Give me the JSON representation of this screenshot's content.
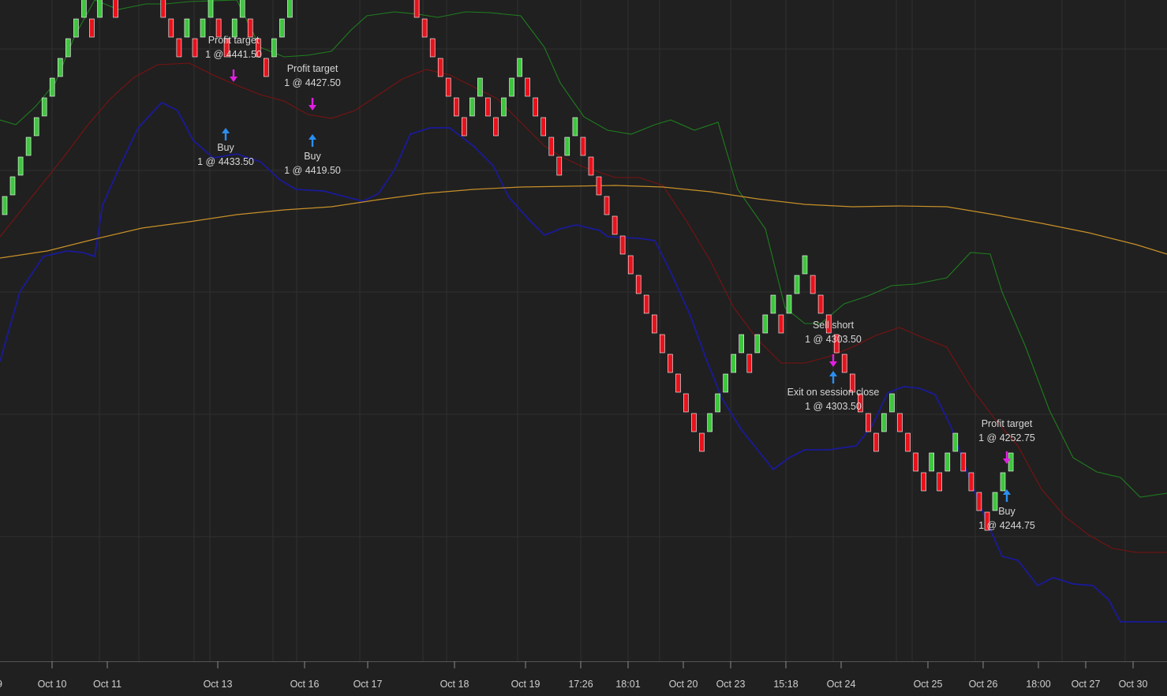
{
  "chart_data": {
    "type": "renko-candlestick",
    "grid": true,
    "colors": {
      "background": "#202020",
      "grid": "#303030",
      "up_bar": "#3ec63e",
      "down_bar": "#e8121c",
      "upper_band": "#1f7d1f",
      "middle_band": "#7a1212",
      "lower_band": "#1a1a9a",
      "long_ma": "#c89028",
      "buy_marker": "#2b8ff0",
      "exit_marker": "#e020e0"
    },
    "x_tick_labels": [
      "Oct 10",
      "Oct 11",
      "Oct 13",
      "Oct 16",
      "Oct 17",
      "Oct 18",
      "Oct 19",
      "17:26",
      "18:01",
      "Oct 20",
      "Oct 23",
      "15:18",
      "Oct 24",
      "Oct 25",
      "Oct 26",
      "18:00",
      "Oct 27",
      "Oct 30"
    ],
    "bricks": [
      "up",
      "up",
      "up",
      "up",
      "up",
      "up",
      "up",
      "up",
      "up",
      "up",
      "up",
      "down",
      "up",
      "up",
      "down",
      "up",
      "up",
      "up",
      "down",
      "down",
      "down",
      "down",
      "down",
      "up",
      "down",
      "up",
      "up",
      "down",
      "down",
      "up",
      "up",
      "down",
      "down",
      "down",
      "up",
      "up",
      "up",
      "up",
      "up",
      "up",
      "up",
      "down",
      "down",
      "down",
      "up",
      "up",
      "up",
      "up",
      "down",
      "down",
      "down",
      "down",
      "down",
      "down",
      "down",
      "down",
      "down",
      "down",
      "down",
      "up",
      "up",
      "down",
      "down",
      "up",
      "up",
      "up",
      "down",
      "down",
      "down",
      "down",
      "down",
      "up",
      "up",
      "down",
      "down",
      "down",
      "down",
      "down",
      "down",
      "down",
      "down",
      "down",
      "down",
      "down",
      "down",
      "down",
      "down",
      "down",
      "down",
      "up",
      "up",
      "up",
      "up",
      "up",
      "down",
      "up",
      "up",
      "up",
      "down",
      "up",
      "up",
      "up",
      "down",
      "down",
      "down",
      "down",
      "down",
      "down",
      "down",
      "down",
      "down",
      "up",
      "up",
      "down",
      "down",
      "down",
      "down",
      "up",
      "down",
      "up",
      "up",
      "down",
      "down",
      "down",
      "down",
      "up",
      "up",
      "up"
    ],
    "trades": [
      {
        "label": "Buy",
        "detail": "1 @ 4433.50",
        "side": "buy"
      },
      {
        "label": "Profit target",
        "detail": "1 @ 4441.50",
        "side": "exit"
      },
      {
        "label": "Buy",
        "detail": "1 @ 4419.50",
        "side": "buy"
      },
      {
        "label": "Profit target",
        "detail": "1 @ 4427.50",
        "side": "exit"
      },
      {
        "label": "Sell short",
        "detail": "1 @ 4303.50",
        "side": "exit"
      },
      {
        "label": "Exit on session close",
        "detail": "1 @ 4303.50",
        "side": "buy"
      },
      {
        "label": "Buy",
        "detail": "1 @ 4244.75",
        "side": "buy"
      },
      {
        "label": "Profit target",
        "detail": "1 @ 4252.75",
        "side": "exit"
      }
    ]
  }
}
